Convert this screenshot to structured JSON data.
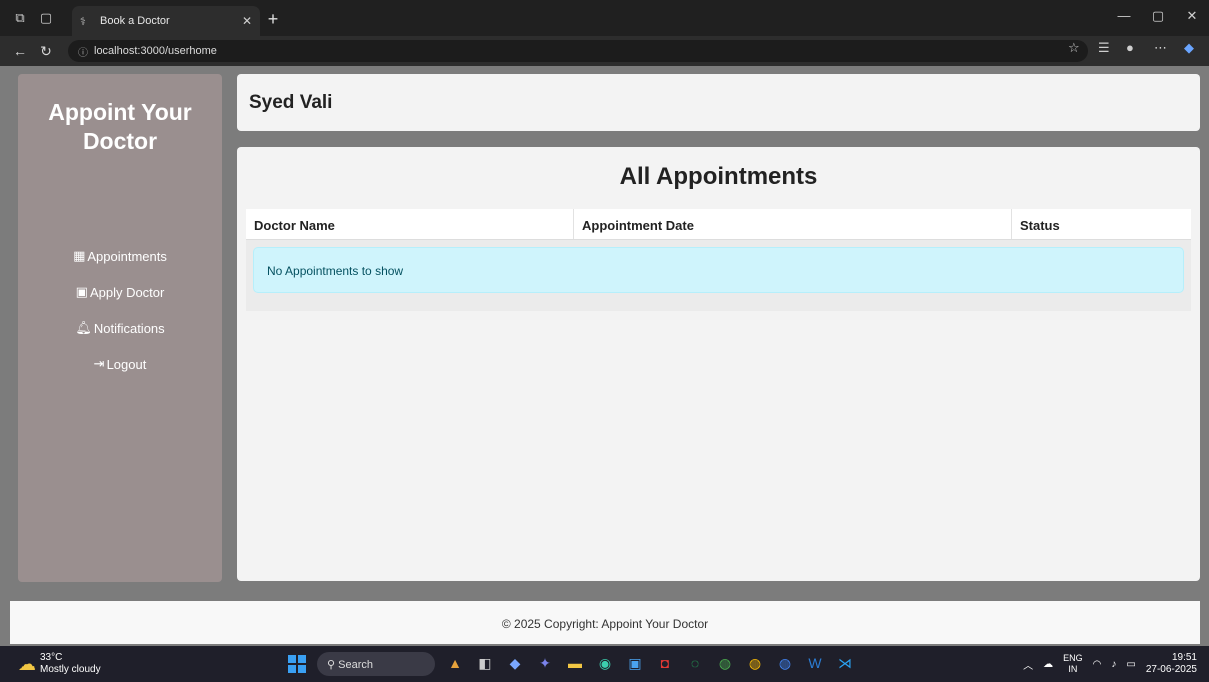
{
  "browser": {
    "tab_title": "Book a Doctor",
    "url": "localhost:3000/userhome"
  },
  "sidebar": {
    "brand": "Appoint Your Doctor",
    "items": [
      {
        "label": "Appointments",
        "icon": "calendar-icon"
      },
      {
        "label": "Apply Doctor",
        "icon": "id-badge-icon"
      },
      {
        "label": "Notifications",
        "icon": "bell-icon"
      },
      {
        "label": "Logout",
        "icon": "logout-icon"
      }
    ]
  },
  "header": {
    "user_name": "Syed Vali"
  },
  "main": {
    "title": "All Appointments",
    "columns": [
      "Doctor Name",
      "Appointment Date",
      "Status"
    ],
    "empty_message": "No Appointments to show"
  },
  "footer": {
    "text": "© 2025 Copyright: Appoint Your Doctor"
  },
  "taskbar": {
    "temperature": "33°C",
    "weather": "Mostly cloudy",
    "search_placeholder": "Search",
    "language": "ENG",
    "region": "IN",
    "time": "19:51",
    "date": "27-06-2025"
  },
  "colors": {
    "sidebar_bg": "#9a8f8f",
    "page_bg": "#7c7c7c",
    "alert_bg": "#cff4fc",
    "alert_text": "#055160"
  }
}
